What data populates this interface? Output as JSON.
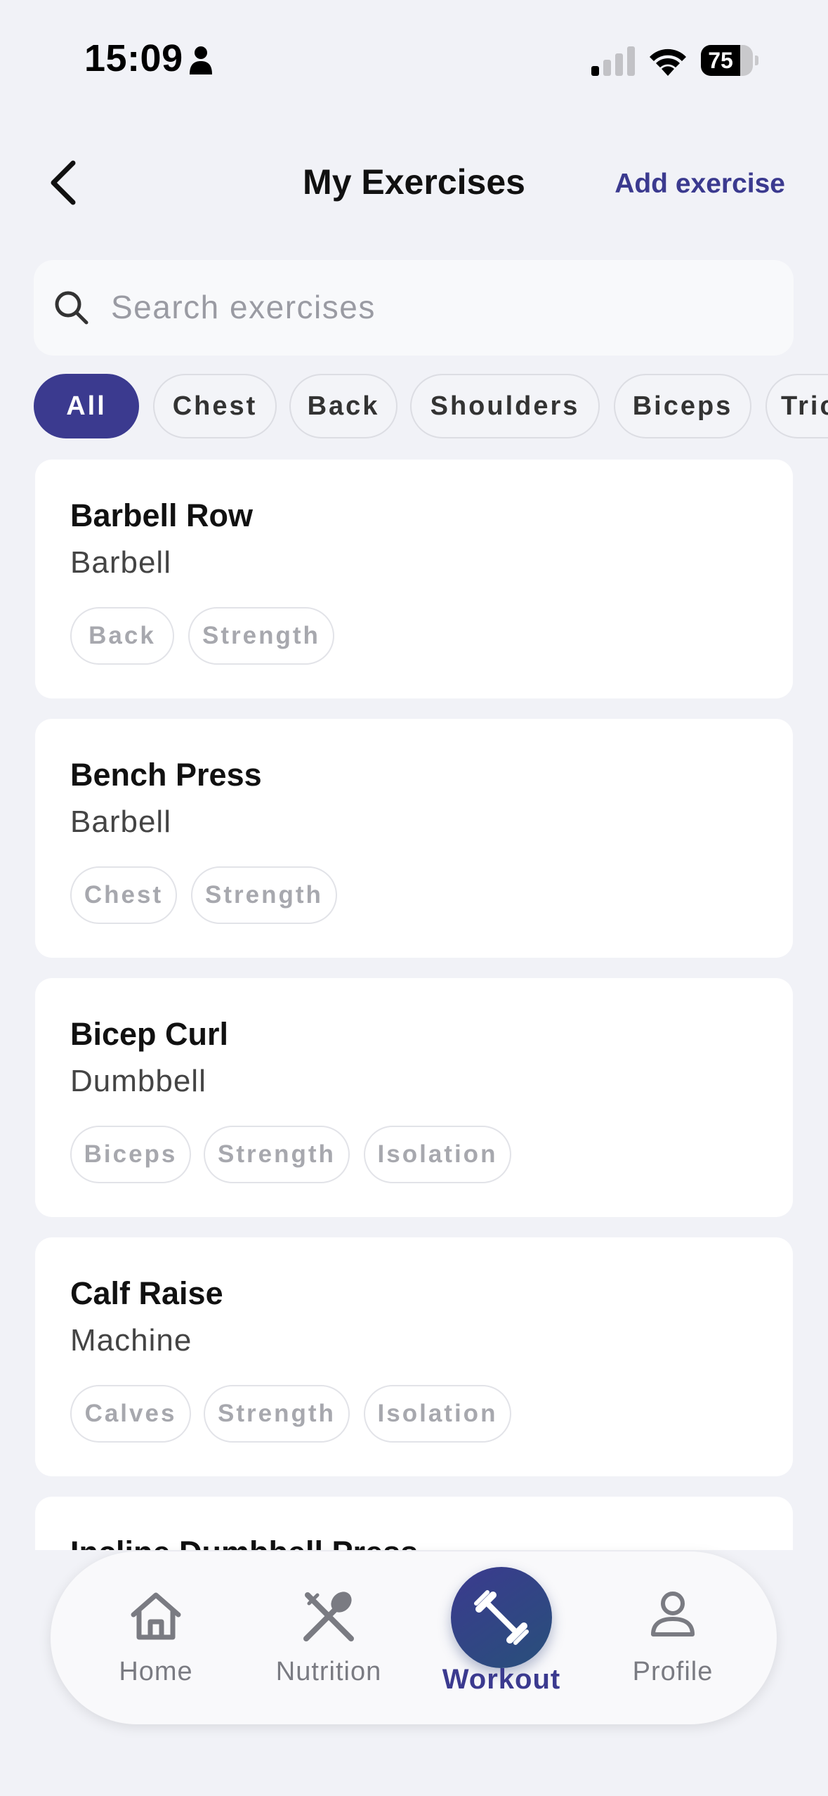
{
  "status_bar": {
    "time": "15:09",
    "battery": 75,
    "battery_label": "75"
  },
  "header": {
    "title": "My Exercises",
    "add_label": "Add exercise"
  },
  "search": {
    "placeholder": "Search exercises"
  },
  "filters": [
    {
      "label": "All",
      "active": true
    },
    {
      "label": "Chest",
      "active": false
    },
    {
      "label": "Back",
      "active": false
    },
    {
      "label": "Shoulders",
      "active": false
    },
    {
      "label": "Biceps",
      "active": false
    },
    {
      "label": "Triceps",
      "active": false
    }
  ],
  "exercises": [
    {
      "name": "Barbell Row",
      "equipment": "Barbell",
      "tags": [
        "Back",
        "Strength"
      ]
    },
    {
      "name": "Bench Press",
      "equipment": "Barbell",
      "tags": [
        "Chest",
        "Strength"
      ]
    },
    {
      "name": "Bicep Curl",
      "equipment": "Dumbbell",
      "tags": [
        "Biceps",
        "Strength",
        "Isolation"
      ]
    },
    {
      "name": "Calf Raise",
      "equipment": "Machine",
      "tags": [
        "Calves",
        "Strength",
        "Isolation"
      ]
    },
    {
      "name": "Incline Dumbbell Press",
      "equipment": "",
      "tags": []
    }
  ],
  "tabs": [
    {
      "label": "Home",
      "icon": "home-icon",
      "active": false
    },
    {
      "label": "Nutrition",
      "icon": "fork-spoon-icon",
      "active": false
    },
    {
      "label": "Workout",
      "icon": "dumbbell-icon",
      "active": true
    },
    {
      "label": "Profile",
      "icon": "person-icon",
      "active": false
    }
  ],
  "colors": {
    "accent": "#3b3a8f",
    "background": "#f1f2f7",
    "card": "#ffffff"
  }
}
